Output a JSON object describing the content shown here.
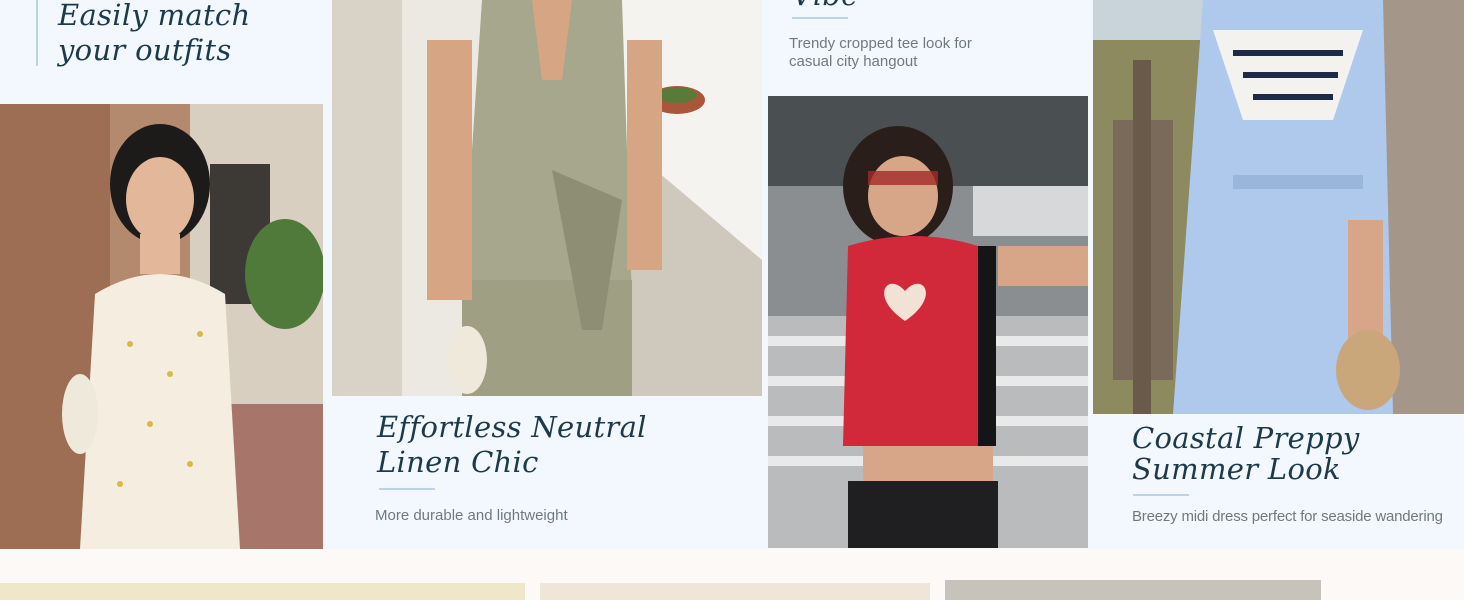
{
  "tiles": [
    {
      "title_line1": "Easily match",
      "title_line2": "your outfits"
    },
    {
      "title_line1": "Effortless Neutral",
      "title_line2": "Linen Chic",
      "caption": "More durable and lightweight"
    },
    {
      "title_line1": "Vibe",
      "caption_line1": "Trendy cropped tee look for",
      "caption_line2": "casual city hangout"
    },
    {
      "title_line1": "Coastal Preppy",
      "title_line2": "Summer Look",
      "caption": "Breezy midi dress perfect for seaside wandering"
    }
  ],
  "photos": [
    {
      "icon": "floral-halter-top-outfit-photo"
    },
    {
      "icon": "linen-vest-trousers-outfit-photo"
    },
    {
      "icon": "red-heart-crop-tee-outfit-photo"
    },
    {
      "icon": "blue-midi-dress-outfit-photo"
    },
    {
      "icon": "bottom-row-photo-left"
    },
    {
      "icon": "bottom-row-photo-middle"
    },
    {
      "icon": "bottom-row-photo-right"
    }
  ],
  "colors": {
    "panel": "#f2f8fd",
    "heading": "#1c3a4a",
    "caption": "#6f7a80",
    "rule": "#bcd3ea"
  }
}
